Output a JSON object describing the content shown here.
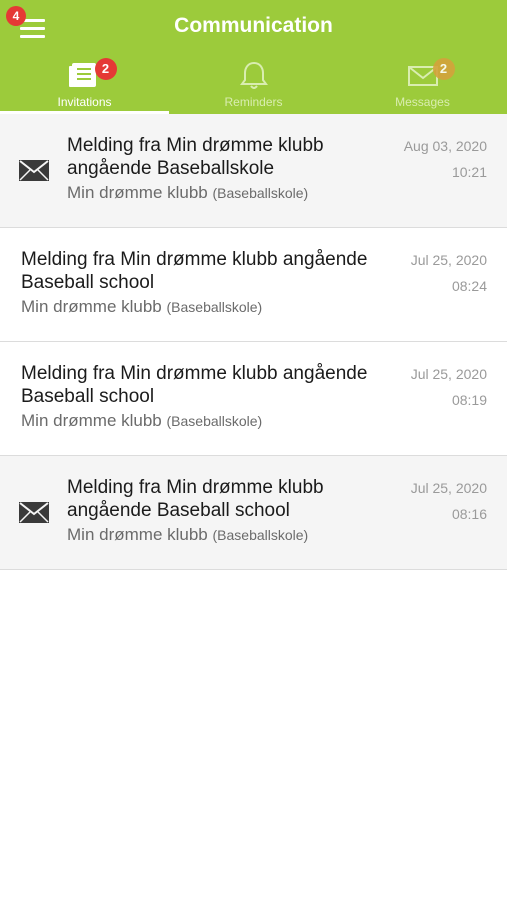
{
  "header": {
    "title": "Communication",
    "menu_badge": "4"
  },
  "tabs": [
    {
      "label": "Invitations",
      "badge": "2",
      "icon": "invitations-icon",
      "active": true
    },
    {
      "label": "Reminders",
      "badge": "",
      "icon": "bell-icon",
      "active": false
    },
    {
      "label": "Messages",
      "badge": "2",
      "icon": "envelope-icon",
      "active": false
    }
  ],
  "messages": [
    {
      "subject": "Melding fra Min drømme klubb angående Baseballskole",
      "sender": "Min drømme klubb",
      "group": "(Baseballskole)",
      "date": "Aug 03, 2020",
      "time": "10:21",
      "unread": true
    },
    {
      "subject": "Melding fra Min drømme klubb angående Baseball school",
      "sender": "Min drømme klubb",
      "group": "(Baseballskole)",
      "date": "Jul 25, 2020",
      "time": "08:24",
      "unread": false
    },
    {
      "subject": "Melding fra Min drømme klubb angående Baseball school",
      "sender": "Min drømme klubb",
      "group": "(Baseballskole)",
      "date": "Jul 25, 2020",
      "time": "08:19",
      "unread": false
    },
    {
      "subject": "Melding fra Min drømme klubb angående Baseball school",
      "sender": "Min drømme klubb",
      "group": "(Baseballskole)",
      "date": "Jul 25, 2020",
      "time": "08:16",
      "unread": true
    }
  ],
  "colors": {
    "brand_green": "#9ccb3b",
    "badge_red": "#e53935",
    "badge_muted": "#d4a23c"
  }
}
